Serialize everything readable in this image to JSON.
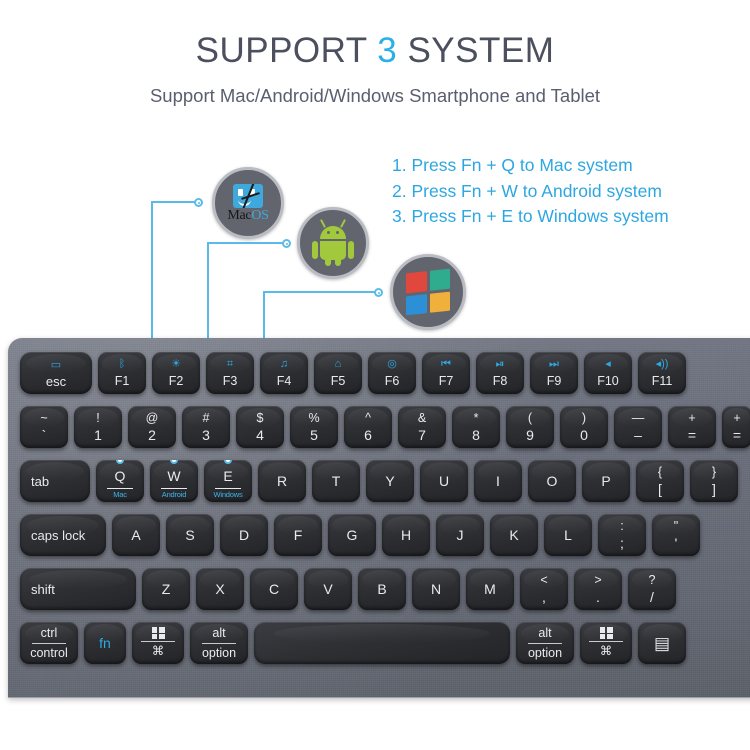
{
  "header": {
    "title_before": "SUPPORT ",
    "title_accent": "3",
    "title_after": " SYSTEM",
    "subtitle": "Support Mac/Android/Windows Smartphone and Tablet",
    "accent_color": "#29b0e8",
    "title_color": "#4c4f5e"
  },
  "instructions": {
    "line1": "1. Press Fn + Q to Mac system",
    "line2": "2. Press Fn + W to Android system",
    "line3": "3. Press Fn + E to Windows system",
    "color": "#2da7e0"
  },
  "badges": {
    "mac": {
      "name": "macos-badge",
      "word_mac": "Mac",
      "word_os": "OS"
    },
    "android": {
      "name": "android-badge"
    },
    "windows": {
      "name": "windows-badge",
      "pane_colors": [
        "#e0483d",
        "#2fab8e",
        "#2d8fd5",
        "#f0b03c"
      ]
    }
  },
  "keyboard": {
    "chassis_color": "#6c707c",
    "key_color": "#2e3034",
    "accent_color": "#2ea9e3",
    "rows": {
      "function": [
        {
          "label": "esc",
          "glyph": "▭⬠",
          "wide": true
        },
        {
          "label": "F1",
          "glyph": "bluetooth"
        },
        {
          "label": "F2",
          "glyph": "brightness"
        },
        {
          "label": "F3",
          "glyph": "screen"
        },
        {
          "label": "F4",
          "glyph": "music"
        },
        {
          "label": "F5",
          "glyph": "search"
        },
        {
          "label": "F6",
          "glyph": "camera"
        },
        {
          "label": "F7",
          "glyph": "⏮"
        },
        {
          "label": "F8",
          "glyph": "⏯"
        },
        {
          "label": "F9",
          "glyph": "⏭"
        },
        {
          "label": "F10",
          "glyph": "◂"
        },
        {
          "label": "F11",
          "glyph": "🔊"
        }
      ],
      "numbers": [
        {
          "top": "~",
          "bottom": "`"
        },
        {
          "top": "!",
          "bottom": "1"
        },
        {
          "top": "@",
          "bottom": "2"
        },
        {
          "top": "#",
          "bottom": "3"
        },
        {
          "top": "$",
          "bottom": "4"
        },
        {
          "top": "%",
          "bottom": "5"
        },
        {
          "top": "^",
          "bottom": "6"
        },
        {
          "top": "&",
          "bottom": "7"
        },
        {
          "top": "*",
          "bottom": "8"
        },
        {
          "top": "(",
          "bottom": "9"
        },
        {
          "top": ")",
          "bottom": "0"
        },
        {
          "top": "—",
          "bottom": "–"
        },
        {
          "top": "+",
          "bottom": "="
        }
      ],
      "qwerty_tab": "tab",
      "qwerty": [
        {
          "label": "Q",
          "os": "Mac"
        },
        {
          "label": "W",
          "os": "Android"
        },
        {
          "label": "E",
          "os": "Windows"
        },
        {
          "label": "R"
        },
        {
          "label": "T"
        },
        {
          "label": "Y"
        },
        {
          "label": "U"
        },
        {
          "label": "I"
        },
        {
          "label": "O"
        },
        {
          "label": "P"
        },
        {
          "top": "{",
          "bottom": "["
        },
        {
          "top": "}",
          "bottom": "]"
        }
      ],
      "home_lead": "caps lock",
      "home": [
        {
          "label": "A"
        },
        {
          "label": "S"
        },
        {
          "label": "D"
        },
        {
          "label": "F"
        },
        {
          "label": "G"
        },
        {
          "label": "H"
        },
        {
          "label": "J"
        },
        {
          "label": "K"
        },
        {
          "label": "L"
        },
        {
          "top": ":",
          "bottom": ";"
        },
        {
          "top": "\"",
          "bottom": "'"
        }
      ],
      "shift_lead": "shift",
      "shift": [
        {
          "label": "Z"
        },
        {
          "label": "X"
        },
        {
          "label": "C"
        },
        {
          "label": "V"
        },
        {
          "label": "B"
        },
        {
          "label": "N"
        },
        {
          "label": "M"
        },
        {
          "top": "<",
          "bottom": ","
        },
        {
          "top": ">",
          "bottom": "."
        },
        {
          "top": "?",
          "bottom": "/"
        }
      ],
      "bottom": [
        {
          "type": "dual",
          "t": "ctrl",
          "b": "control"
        },
        {
          "type": "fn",
          "label": "fn"
        },
        {
          "type": "win-cmd",
          "b": "⌘"
        },
        {
          "type": "dual",
          "t": "alt",
          "b": "option"
        },
        {
          "type": "space"
        },
        {
          "type": "dual",
          "t": "alt",
          "b": "option"
        },
        {
          "type": "win-cmd",
          "b": "⌘"
        },
        {
          "type": "menu",
          "label": "▤"
        }
      ]
    }
  }
}
